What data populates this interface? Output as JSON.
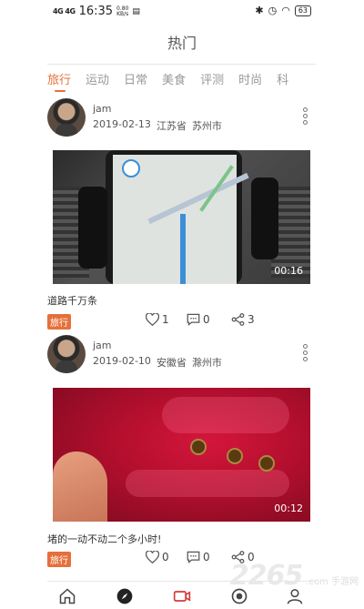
{
  "status_bar": {
    "network": "4G 4G",
    "time": "16:35",
    "speed_top": "0.80",
    "speed_bottom": "KB/s",
    "battery": "63"
  },
  "header": {
    "title": "热门"
  },
  "tabs": [
    "旅行",
    "运动",
    "日常",
    "美食",
    "评测",
    "时尚",
    "科"
  ],
  "posts": [
    {
      "username": "jam",
      "date": "2019-02-13",
      "province": "江苏省",
      "city": "苏州市",
      "duration": "00:16",
      "caption": "道路千万条",
      "tag": "旅行",
      "likes": "1",
      "comments": "0",
      "shares": "3"
    },
    {
      "username": "jam",
      "date": "2019-02-10",
      "province": "安徽省",
      "city": "滁州市",
      "duration": "00:12",
      "caption": "堵的一动不动二个多小时!",
      "tag": "旅行",
      "likes": "0",
      "comments": "0",
      "shares": "0"
    }
  ],
  "bottom_nav": [
    {
      "icon": "home-icon"
    },
    {
      "icon": "compass-icon"
    },
    {
      "icon": "video-camera-icon"
    },
    {
      "icon": "eye-icon"
    },
    {
      "icon": "user-icon"
    }
  ],
  "watermark": {
    "number": "2265",
    "suffix": ".com",
    "text": "手游网"
  },
  "colors": {
    "accent": "#e6703a",
    "text": "#333333",
    "muted": "#999999"
  }
}
